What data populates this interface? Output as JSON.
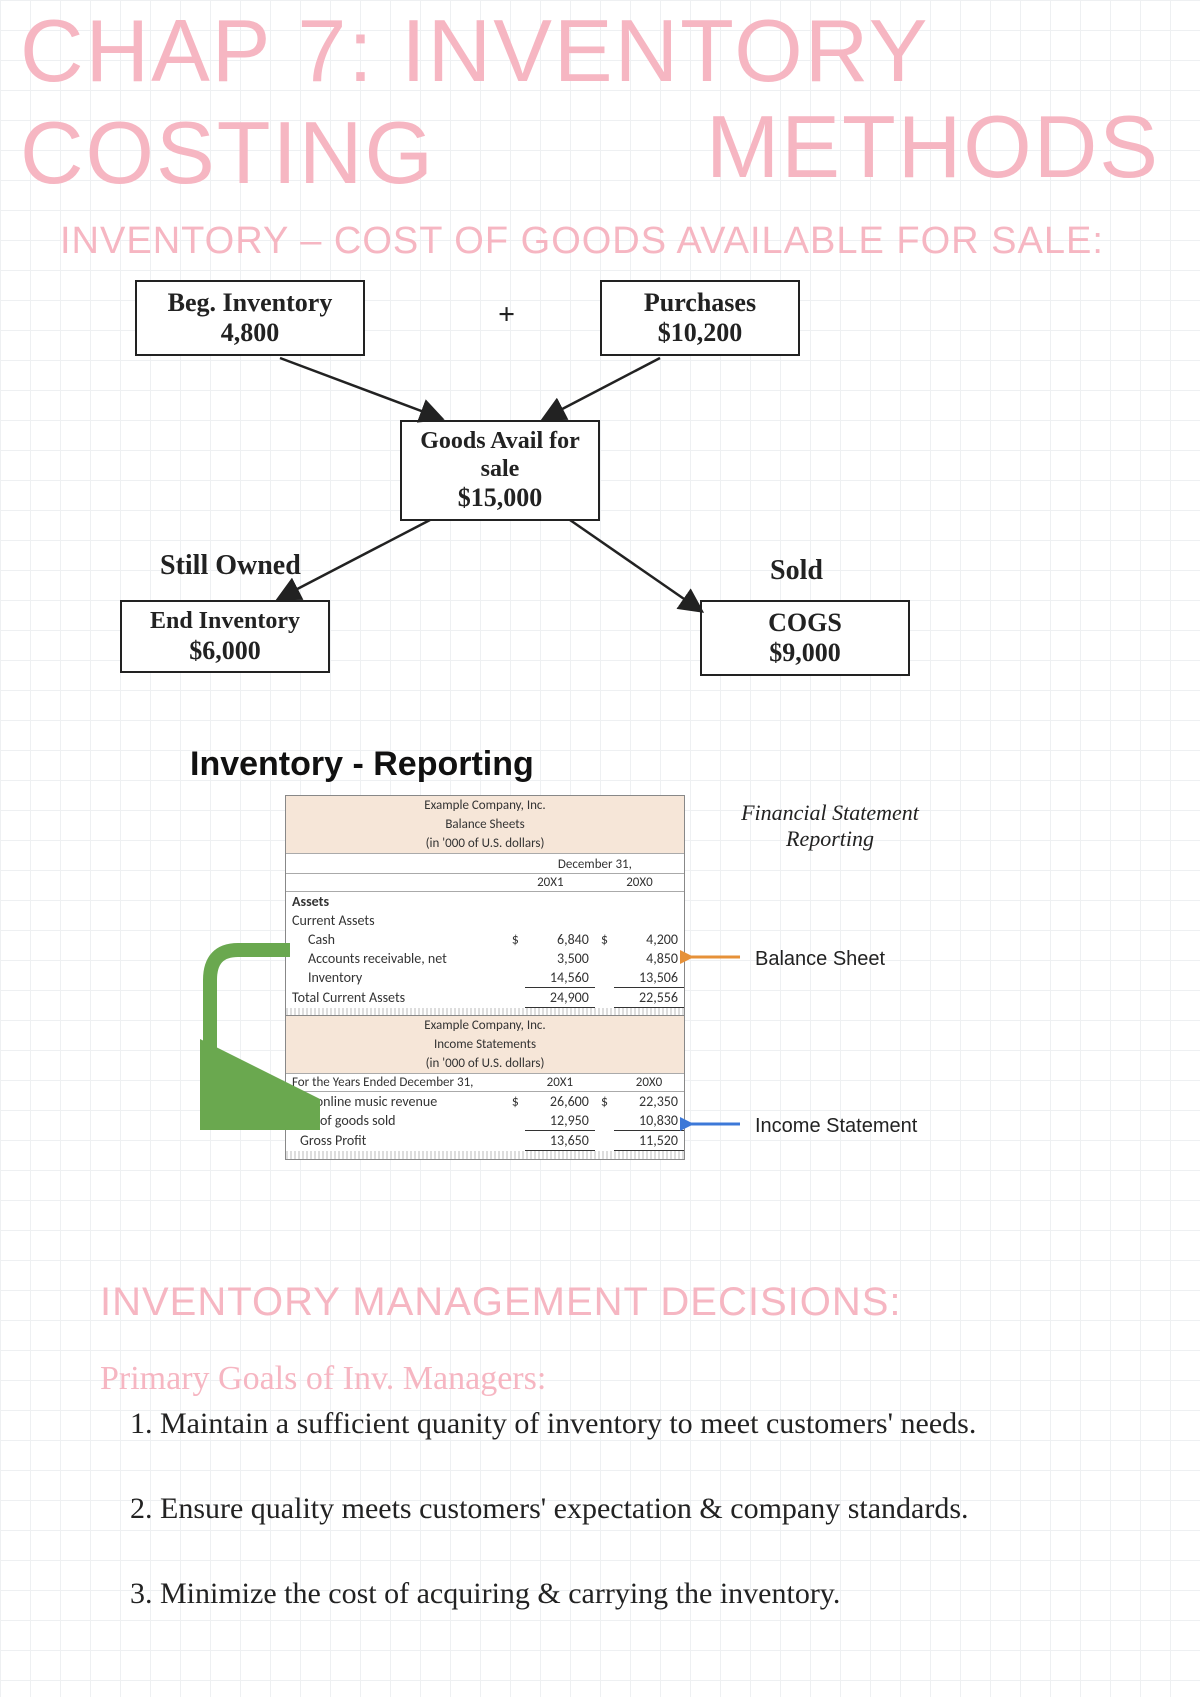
{
  "title_line1": "CHAP 7: INVENTORY COSTING",
  "title_line2": "METHODS",
  "section1": "INVENTORY – COST OF GOODS AVAILABLE FOR SALE:",
  "diagram": {
    "beg_label": "Beg. Inventory",
    "beg_value": "4,800",
    "plus": "+",
    "purch_label": "Purchases",
    "purch_value": "$10,200",
    "goods_label": "Goods Avail for sale",
    "goods_value": "$15,000",
    "still_owned": "Still Owned",
    "end_label": "End Inventory",
    "end_value": "$6,000",
    "sold": "Sold",
    "cogs_label": "COGS",
    "cogs_value": "$9,000"
  },
  "reporting": {
    "heading": "Inventory - Reporting",
    "fin_stmt": "Financial Statement Reporting",
    "bs_anno": "Balance Sheet",
    "is_anno": "Income Statement",
    "balance_sheet": {
      "co": "Example Company, Inc.",
      "title": "Balance Sheets",
      "sub": "(in '000 of U.S. dollars)",
      "period_head": "December 31,",
      "col1": "20X1",
      "col2": "20X0",
      "assets": "Assets",
      "cur_assets": "Current Assets",
      "rows": [
        {
          "label": "Cash",
          "a": "6,840",
          "b": "4,200"
        },
        {
          "label": "Accounts receivable, net",
          "a": "3,500",
          "b": "4,850"
        },
        {
          "label": "Inventory",
          "a": "14,560",
          "b": "13,506"
        }
      ],
      "total_label": "Total Current Assets",
      "total_a": "24,900",
      "total_b": "22,556"
    },
    "income_stmt": {
      "co": "Example Company, Inc.",
      "title": "Income Statements",
      "sub": "(in '000 of U.S. dollars)",
      "period_row": "For the Years Ended December 31,",
      "col1": "20X1",
      "col2": "20X0",
      "rows": [
        {
          "label": "Net online music revenue",
          "a": "26,600",
          "b": "22,350"
        },
        {
          "label": "Cost of goods sold",
          "a": "12,950",
          "b": "10,830"
        }
      ],
      "gp_label": "Gross Profit",
      "gp_a": "13,650",
      "gp_b": "11,520"
    }
  },
  "section2": "INVENTORY MANAGEMENT DECISIONS:",
  "goals_heading": "Primary Goals of Inv. Managers:",
  "goals": [
    "1. Maintain a sufficient quanity of inventory to meet customers' needs.",
    "2. Ensure quality meets customers' expectation & company standards.",
    "3. Minimize the cost of acquiring & carrying the inventory."
  ]
}
